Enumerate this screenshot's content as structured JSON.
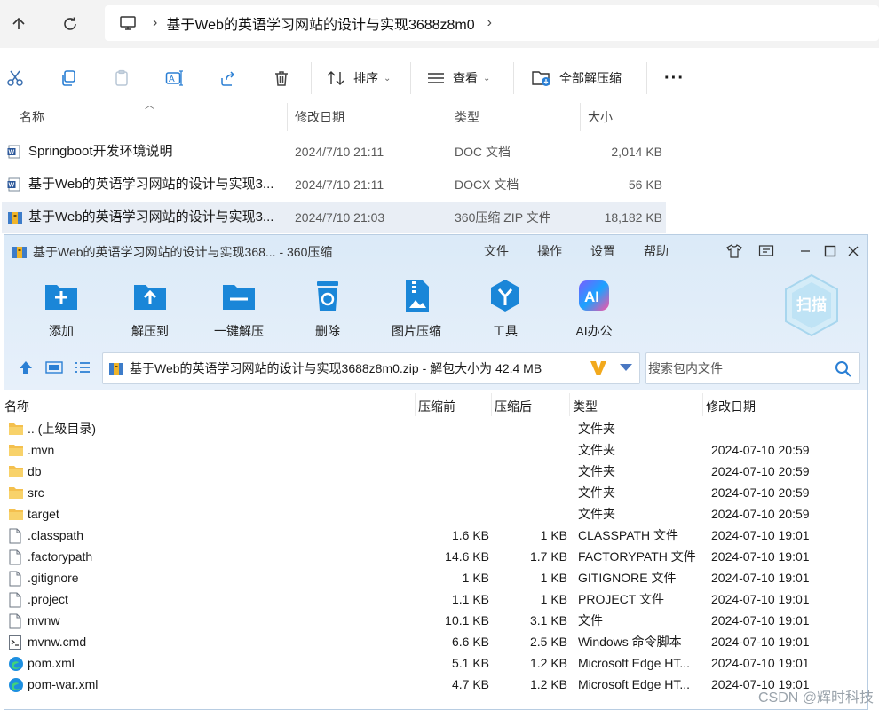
{
  "explorer": {
    "address_path": "基于Web的英语学习网站的设计与实现3688z8m0",
    "toolbar": {
      "sort_label": "排序",
      "view_label": "查看",
      "extract_all_label": "全部解压缩"
    },
    "columns": {
      "name": "名称",
      "modified": "修改日期",
      "type": "类型",
      "size": "大小"
    },
    "files": [
      {
        "name": "Springboot开发环境说明",
        "date": "2024/7/10 21:11",
        "type": "DOC 文档",
        "size": "2,014 KB",
        "icon": "word-doc-icon"
      },
      {
        "name": "基于Web的英语学习网站的设计与实现3...",
        "date": "2024/7/10 21:11",
        "type": "DOCX 文档",
        "size": "56 KB",
        "icon": "word-doc-icon"
      },
      {
        "name": "基于Web的英语学习网站的设计与实现3...",
        "date": "2024/7/10 21:03",
        "type": "360压缩 ZIP 文件",
        "size": "18,182 KB",
        "icon": "zip-archive-icon",
        "selected": true
      }
    ]
  },
  "zip_window": {
    "title": "基于Web的英语学习网站的设计与实现368... - 360压缩",
    "menu": {
      "file": "文件",
      "operate": "操作",
      "settings": "设置",
      "help": "帮助"
    },
    "tools": {
      "add": "添加",
      "extract_to": "解压到",
      "one_click": "一键解压",
      "delete": "删除",
      "image_compress": "图片压缩",
      "tools": "工具",
      "ai_office": "AI办公"
    },
    "scan_label": "扫描",
    "path_text": "基于Web的英语学习网站的设计与实现3688z8m0.zip - 解包大小为 42.4 MB",
    "search_placeholder": "搜索包内文件",
    "columns": {
      "name": "名称",
      "before": "压缩前",
      "after": "压缩后",
      "type": "类型",
      "modified": "修改日期"
    },
    "rows": [
      {
        "name": ".. (上级目录)",
        "before": "",
        "after": "",
        "type": "文件夹",
        "date": "",
        "icon": "folder-icon"
      },
      {
        "name": ".mvn",
        "before": "",
        "after": "",
        "type": "文件夹",
        "date": "2024-07-10 20:59",
        "icon": "folder-icon"
      },
      {
        "name": "db",
        "before": "",
        "after": "",
        "type": "文件夹",
        "date": "2024-07-10 20:59",
        "icon": "folder-icon"
      },
      {
        "name": "src",
        "before": "",
        "after": "",
        "type": "文件夹",
        "date": "2024-07-10 20:59",
        "icon": "folder-icon"
      },
      {
        "name": "target",
        "before": "",
        "after": "",
        "type": "文件夹",
        "date": "2024-07-10 20:59",
        "icon": "folder-icon"
      },
      {
        "name": ".classpath",
        "before": "1.6 KB",
        "after": "1 KB",
        "type": "CLASSPATH 文件",
        "date": "2024-07-10 19:01",
        "icon": "file-icon"
      },
      {
        "name": ".factorypath",
        "before": "14.6 KB",
        "after": "1.7 KB",
        "type": "FACTORYPATH 文件",
        "date": "2024-07-10 19:01",
        "icon": "file-icon"
      },
      {
        "name": ".gitignore",
        "before": "1 KB",
        "after": "1 KB",
        "type": "GITIGNORE 文件",
        "date": "2024-07-10 19:01",
        "icon": "file-icon"
      },
      {
        "name": ".project",
        "before": "1.1 KB",
        "after": "1 KB",
        "type": "PROJECT 文件",
        "date": "2024-07-10 19:01",
        "icon": "file-icon"
      },
      {
        "name": "mvnw",
        "before": "10.1 KB",
        "after": "3.1 KB",
        "type": "文件",
        "date": "2024-07-10 19:01",
        "icon": "file-icon"
      },
      {
        "name": "mvnw.cmd",
        "before": "6.6 KB",
        "after": "2.5 KB",
        "type": "Windows 命令脚本",
        "date": "2024-07-10 19:01",
        "icon": "cmd-script-icon"
      },
      {
        "name": "pom.xml",
        "before": "5.1 KB",
        "after": "1.2 KB",
        "type": "Microsoft Edge HT...",
        "date": "2024-07-10 19:01",
        "icon": "edge-icon"
      },
      {
        "name": "pom-war.xml",
        "before": "4.7 KB",
        "after": "1.2 KB",
        "type": "Microsoft Edge HT...",
        "date": "2024-07-10 19:01",
        "icon": "edge-icon"
      }
    ]
  },
  "watermark": "CSDN @辉时科技",
  "colors": {
    "accent_blue": "#1a86d8",
    "toolbar_bg": "#dbeaf8",
    "selected_row": "#e9eef5",
    "folder_yellow": "#f4c04e"
  }
}
